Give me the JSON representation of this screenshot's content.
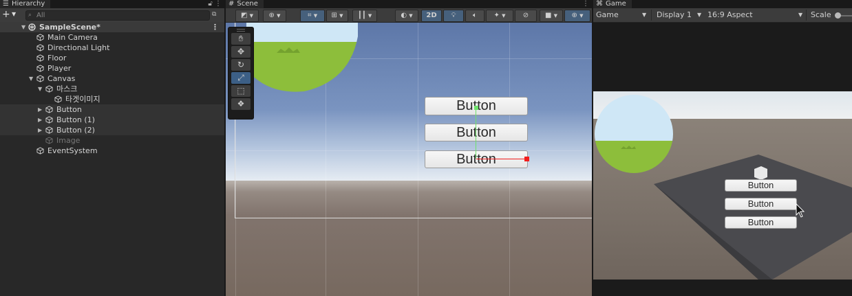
{
  "hierarchy": {
    "tab_title": "Hierarchy",
    "search_placeholder": "All",
    "items": [
      {
        "label": "SampleScene*",
        "depth": 0,
        "kind": "scene"
      },
      {
        "label": "Main Camera",
        "depth": 1
      },
      {
        "label": "Directional Light",
        "depth": 1
      },
      {
        "label": "Floor",
        "depth": 1
      },
      {
        "label": "Player",
        "depth": 1
      },
      {
        "label": "Canvas",
        "depth": 1,
        "expanded": true
      },
      {
        "label": "마스크",
        "depth": 2,
        "expanded": true
      },
      {
        "label": "타겟이미지",
        "depth": 3
      },
      {
        "label": "Button",
        "depth": 2,
        "collapsed": true,
        "selected": true
      },
      {
        "label": "Button (1)",
        "depth": 2,
        "collapsed": true,
        "selected": true
      },
      {
        "label": "Button (2)",
        "depth": 2,
        "collapsed": true,
        "selected": true
      },
      {
        "label": "Image",
        "depth": 2,
        "inactive": true
      },
      {
        "label": "EventSystem",
        "depth": 1
      }
    ]
  },
  "scene": {
    "tab_title": "Scene",
    "toolbar": {
      "mode_2d": "2D"
    },
    "ui_buttons": [
      "Button",
      "Button",
      "Button"
    ]
  },
  "game": {
    "tab_title": "Game",
    "view_dropdown": "Game",
    "display_dropdown": "Display 1",
    "aspect_dropdown": "16:9 Aspect",
    "scale_label": "Scale",
    "ui_buttons": [
      "Button",
      "Button",
      "Button"
    ]
  },
  "colors": {
    "panel_bg": "#282828",
    "toolbar_bg": "#3c3c3c",
    "selection": "#333333",
    "accent_blue": "#3c5f86",
    "gizmo_green": "#6ee26b",
    "gizmo_red": "#f21d1d",
    "grass_green": "#8dbe3b"
  }
}
